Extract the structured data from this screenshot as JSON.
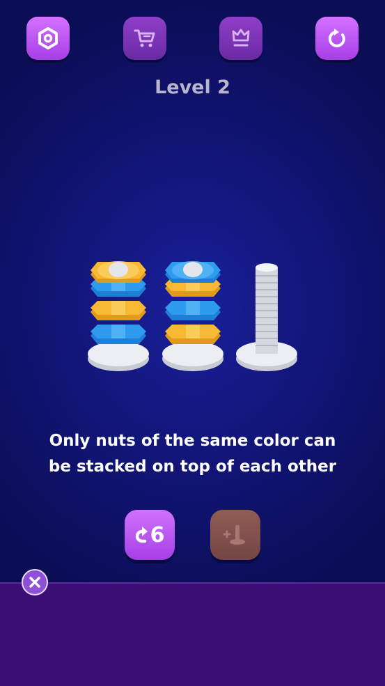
{
  "toolbar": {
    "settings_icon": "gear-icon",
    "shop_icon": "cart-icon",
    "leaderboard_icon": "crown-icon",
    "restart_icon": "restart-icon"
  },
  "level": {
    "title": "Level 2"
  },
  "board": {
    "nut_colors": {
      "yellow": "#f7b933",
      "blue": "#2f9bef"
    },
    "bolts": [
      {
        "nuts_bottom_to_top": [
          "blue",
          "yellow",
          "blue",
          "yellow"
        ]
      },
      {
        "nuts_bottom_to_top": [
          "yellow",
          "blue",
          "yellow",
          "blue"
        ]
      },
      {
        "nuts_bottom_to_top": []
      }
    ]
  },
  "hint": {
    "line1": "Only nuts of the same color can",
    "line2": "be stacked on top of each other"
  },
  "actions": {
    "undo_count": "6",
    "undo_icon": "undo-arrow-icon",
    "add_bolt_icon": "add-bolt-icon"
  },
  "ad_panel": {
    "close_icon": "close-icon"
  },
  "colors": {
    "accent": "#b550f0",
    "panel": "#3a0e74"
  }
}
